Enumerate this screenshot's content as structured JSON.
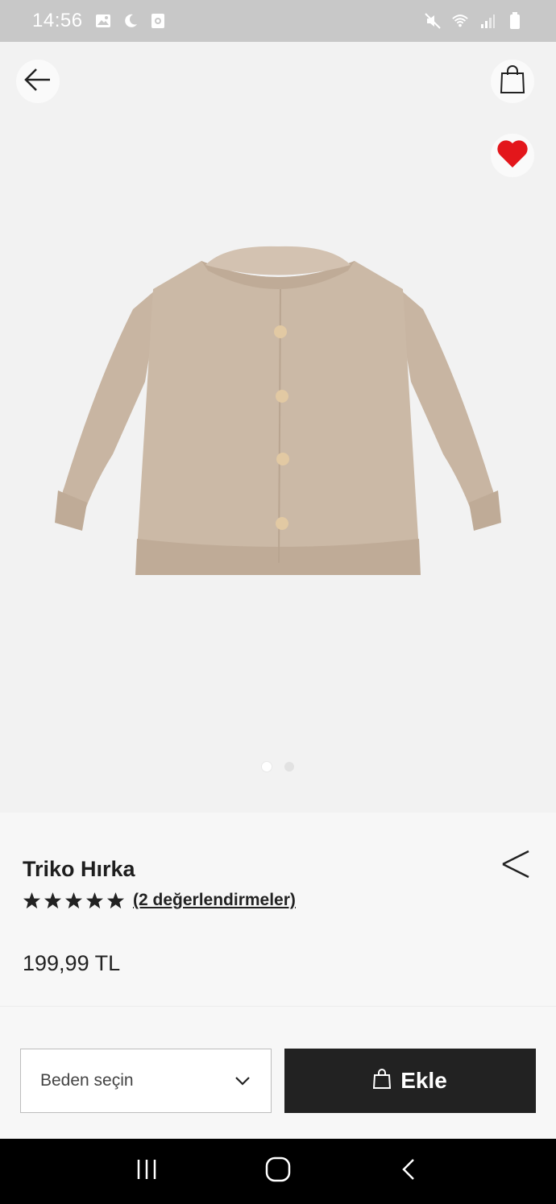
{
  "status_bar": {
    "time": "14:56",
    "left_icons": [
      "image-icon",
      "moon-icon",
      "screen-record-icon"
    ],
    "right_icons": [
      "mute-icon",
      "wifi-icon",
      "signal-icon",
      "battery-icon"
    ]
  },
  "header": {
    "back_icon": "arrow-left-icon",
    "bag_icon": "shopping-bag-icon",
    "favorite_icon": "heart-icon",
    "favorite_color": "#e3161b"
  },
  "gallery": {
    "product_color": "#c9b7a4",
    "dots_total": 2,
    "active_dot": 1
  },
  "product": {
    "title": "Triko Hırka",
    "rating_stars": 5,
    "reviews_text": "(2 değerlendirmeler)",
    "price": "199,99 TL"
  },
  "actions": {
    "size_placeholder": "Beden seçin",
    "add_label": "Ekle"
  },
  "nav": {
    "recents_icon": "recents-icon",
    "home_icon": "home-icon",
    "back_icon": "back-icon"
  }
}
